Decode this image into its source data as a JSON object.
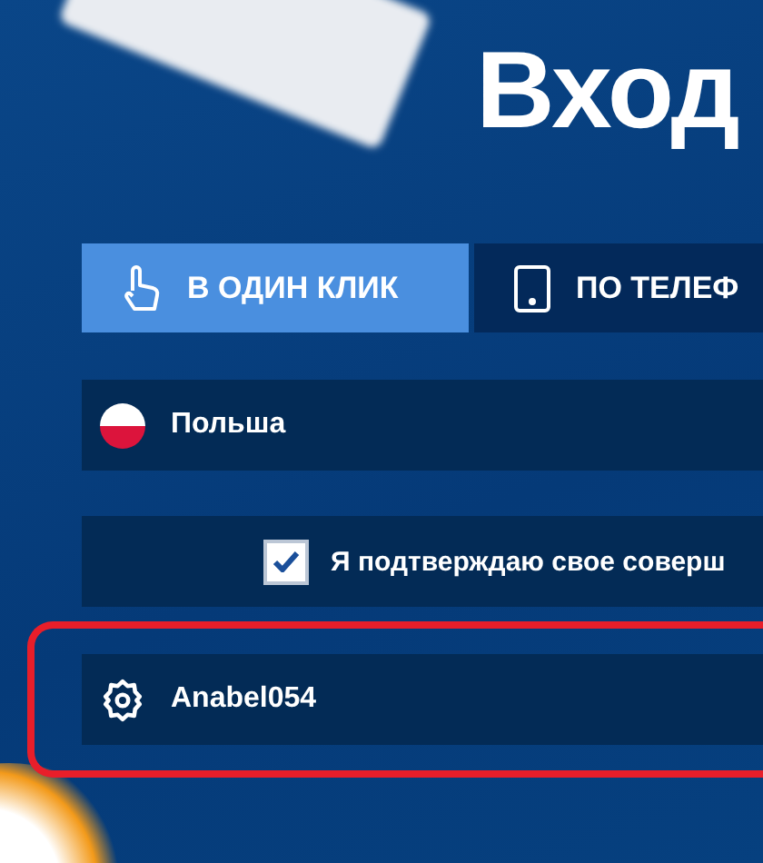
{
  "title": "Вход",
  "tabs": [
    {
      "label": "В ОДИН КЛИК",
      "selected": true
    },
    {
      "label": "ПО ТЕЛЕФ",
      "selected": false
    }
  ],
  "country": {
    "value": "Польша"
  },
  "confirm": {
    "label": "Я подтверждаю свое соверш",
    "checked": true
  },
  "username": {
    "value": "Anabel054",
    "highlighted": true
  }
}
